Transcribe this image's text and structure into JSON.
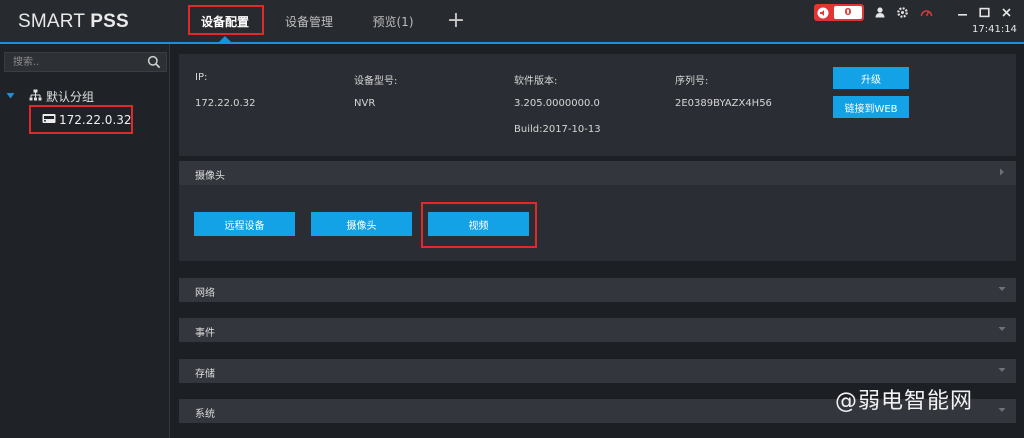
{
  "app": {
    "brand_light": "SMART ",
    "brand_bold": "PSS"
  },
  "tabs": [
    {
      "label": "设备配置",
      "active": true
    },
    {
      "label": "设备管理",
      "active": false
    },
    {
      "label": "预览(1)",
      "active": false
    }
  ],
  "add_tab_label": "+",
  "toolbar": {
    "alarm_count": "0",
    "time": "17:41:14",
    "icons": [
      "speaker-icon",
      "user-icon",
      "gear-icon",
      "gauge-icon",
      "minimize-icon",
      "maximize-icon",
      "close-icon"
    ]
  },
  "sidebar": {
    "search_placeholder": "搜索..",
    "group": {
      "label": "默认分组"
    },
    "device": {
      "label": "172.22.0.32"
    }
  },
  "device_info": {
    "ip_label": "IP:",
    "ip_value": "172.22.0.32",
    "model_label": "设备型号:",
    "model_value": "NVR",
    "software_label": "软件版本:",
    "software_value": "3.205.0000000.0",
    "build_value": "Build:2017-10-13",
    "serial_label": "序列号:",
    "serial_value": "2E0389BYAZX4H56",
    "upgrade_button": "升级",
    "web_button": "链接到WEB"
  },
  "camera_section": {
    "title": "摄像头",
    "buttons": [
      "远程设备",
      "摄像头",
      "视频"
    ]
  },
  "sections": [
    {
      "title": "网络"
    },
    {
      "title": "事件"
    },
    {
      "title": "存储"
    },
    {
      "title": "系统"
    }
  ],
  "watermark": "@弱电智能网",
  "colors": {
    "accent": "#1e8fd4",
    "button": "#14a2e6",
    "alarm": "#e23434",
    "highlight_frame": "#e02a2a"
  }
}
